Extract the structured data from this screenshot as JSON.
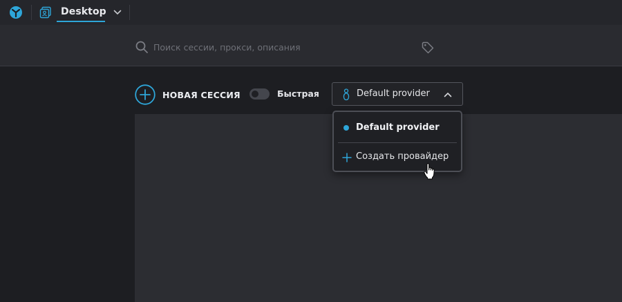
{
  "colors": {
    "accent": "#2ea6d9",
    "background": "#1d1e22",
    "topbar": "#25262b",
    "panel": "#2c2d32"
  },
  "topbar": {
    "logo_icon": "app-logo-icon",
    "workspace_icon": "profiles-icon",
    "workspace_name": "Desktop",
    "workspace_chevron_icon": "chevron-down-icon"
  },
  "search": {
    "icon": "search-icon",
    "value": "",
    "placeholder": "Поиск сессии, прокси, описания",
    "tag_icon": "tag-icon"
  },
  "toolbar": {
    "new_session_label": "НОВАЯ СЕССИЯ",
    "quick_toggle_label": "Быстрая",
    "quick_toggle_on": false,
    "provider_icon": "person-icon",
    "provider_value": "Default provider",
    "provider_chevron_icon": "chevron-up-icon"
  },
  "provider_dropdown": {
    "items": [
      {
        "label": "Default provider",
        "selected": true
      },
      {
        "label": "Создать провайдер",
        "icon": "plus-icon"
      }
    ]
  }
}
